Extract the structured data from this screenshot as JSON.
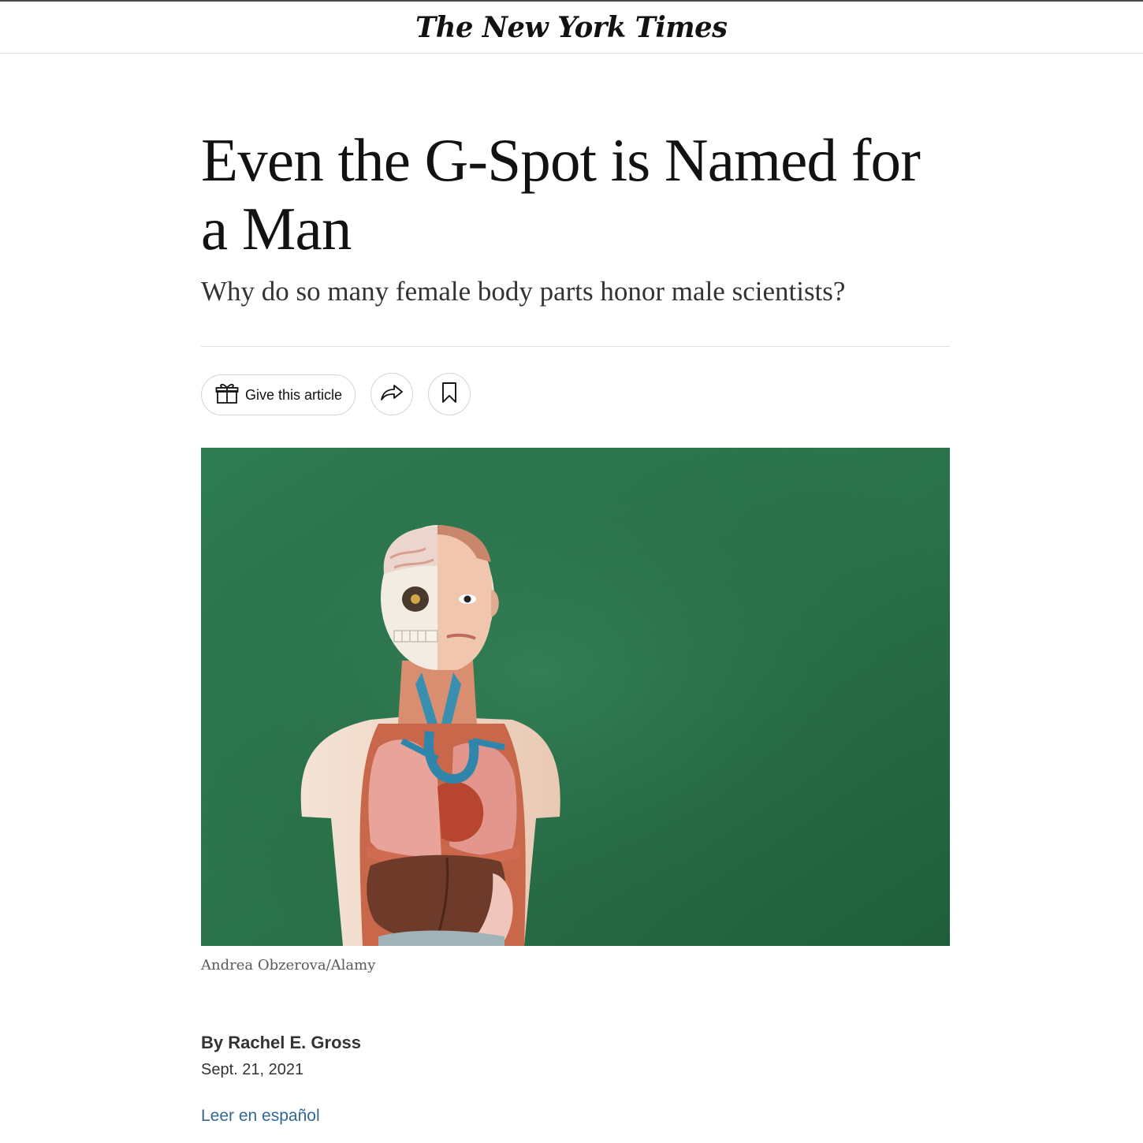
{
  "masthead": {
    "logo_text": "The New York Times",
    "logo_icon": "nyt-wordmark"
  },
  "article": {
    "headline": "Even the G-Spot is Named for a Man",
    "summary": "Why do so many female body parts honor male scientists?",
    "actions": {
      "gift_label": "Give this article",
      "gift_icon": "gift-icon",
      "share_icon": "share-arrow-icon",
      "save_icon": "bookmark-icon"
    },
    "image": {
      "subject": "anatomical torso model in front of a green chalkboard",
      "background_color": "#2e7a4f",
      "credit": "Andrea Obzerova/Alamy"
    },
    "byline": "By Rachel E. Gross",
    "date": "Sept. 21, 2021",
    "translation_link": "Leer en español"
  },
  "colors": {
    "text": "#121212",
    "link": "#326891",
    "rule": "#dfdfdf"
  }
}
